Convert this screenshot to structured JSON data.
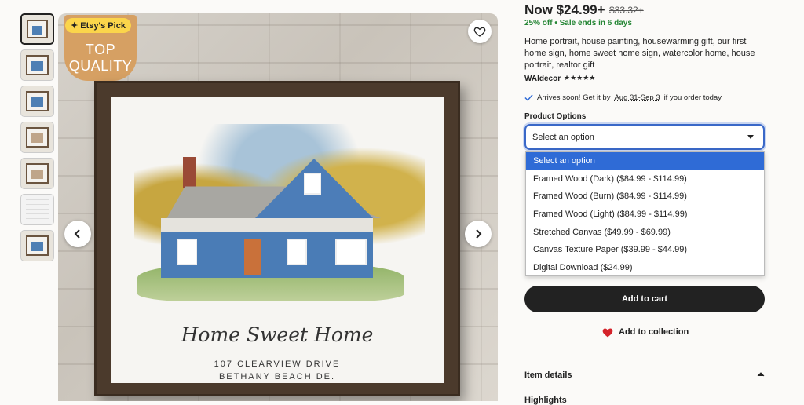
{
  "gallery": {
    "thumbnail_count": 7,
    "badge_text": "TOP QUALITY",
    "etsy_pick": "Etsy's Pick",
    "caption_line1": "Home Sweet Home",
    "caption_line2": "107 CLEARVIEW DRIVE",
    "caption_line3": "BETHANY BEACH DE."
  },
  "product": {
    "price": "Now $24.99+",
    "original_price": "$33.32+",
    "discount": "25% off",
    "sale_ends": "Sale ends in 6 days",
    "title": "Home portrait, house painting, housewarming gift, our first home sign, home sweet home sign, watercolor home, house portrait, realtor gift",
    "shop": "WAldecor",
    "stars": "★★★★★",
    "arrives_prefix": "Arrives soon! Get it by",
    "arrives_dates": "Aug 31-Sep 3",
    "arrives_suffix": "if you order today"
  },
  "options": {
    "label": "Product Options",
    "selected": "Select an option",
    "items": [
      "Select an option",
      "Framed Wood (Dark) ($84.99 - $114.99)",
      "Framed Wood (Burn) ($84.99 - $114.99)",
      "Framed Wood (Light) ($84.99 - $114.99)",
      "Stretched Canvas ($49.99 - $69.99)",
      "Canvas Texture Paper ($39.99 - $44.99)",
      "Digital Download ($24.99)"
    ]
  },
  "actions": {
    "add_to_cart": "Add to cart",
    "add_to_collection": "Add to collection"
  },
  "sections": {
    "item_details": "Item details",
    "highlights": "Highlights"
  },
  "colors": {
    "accent_blue": "#2f6bd6",
    "sale_green": "#258635",
    "heart_red": "#d4222a"
  }
}
